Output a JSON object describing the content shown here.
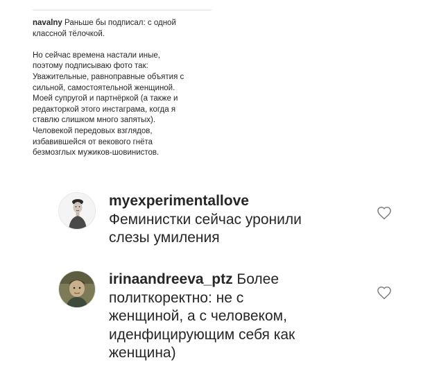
{
  "caption": {
    "username": "navalny",
    "first_line": "Раньше бы подписал: с одной",
    "lines": [
      "классной тёлочкой.",
      "",
      "Но сейчас времена настали иные,",
      "поэтому подписываю фото так:",
      "Уважительные, равноправные объятия с",
      "сильной, самостоятельной женщиной.",
      "Моей супругой и партнёркой (а также и",
      "редакторкой этого инстаграма, когда я",
      "ставлю слишком много запятых).",
      "Человекой передовых взглядов,",
      "избавившейся от векового гнёта",
      "безмозглых мужиков-шовинистов."
    ]
  },
  "comments": [
    {
      "username": "myexperimentallove",
      "text_lines": [
        "Феминистки сейчас уронили",
        "слезы умиления"
      ],
      "avatar": "avatar-woman-portrait",
      "like_icon": "heart-outline-icon"
    },
    {
      "username": "irinaandreeva_ptz",
      "first_line_text": "Более",
      "text_lines": [
        "политкоректно: не с",
        "женщиной, а с человеком,",
        "иденфицирующим себя как",
        "женщина)"
      ],
      "avatar": "avatar-child-photo",
      "like_icon": "heart-outline-icon"
    }
  ]
}
